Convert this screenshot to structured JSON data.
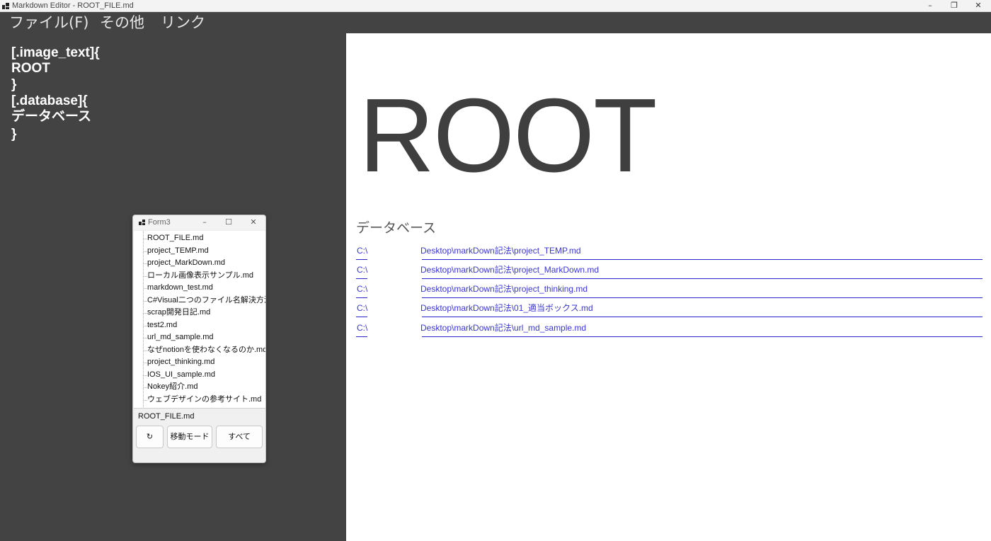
{
  "window": {
    "title": "Markdown Editor - ROOT_FILE.md",
    "controls": {
      "minimize": "–",
      "restore": "❐",
      "close": "✕"
    },
    "icon": "app-icon"
  },
  "menu": {
    "items": [
      "ファイル(F)",
      "その他",
      "リンク"
    ]
  },
  "editor": {
    "lines": [
      "[.image_text]{",
      "ROOT",
      "}",
      "[.database]{",
      "データベース",
      "}"
    ]
  },
  "preview": {
    "title": "ROOT",
    "section_heading": "データベース",
    "links": [
      {
        "drive": "C:\\",
        "path": "Desktop\\markDown記法\\project_TEMP.md"
      },
      {
        "drive": "C:\\",
        "path": "Desktop\\markDown記法\\project_MarkDown.md"
      },
      {
        "drive": "C:\\",
        "path": "Desktop\\markDown記法\\project_thinking.md"
      },
      {
        "drive": "C:\\",
        "path": "Desktop\\markDown記法\\01_適当ボックス.md"
      },
      {
        "drive": "C:\\",
        "path": "Desktop\\markDown記法\\url_md_sample.md"
      }
    ],
    "link_color": "#3a37d0"
  },
  "form3": {
    "title": "Form3",
    "controls": {
      "minimize": "–",
      "maximize": "☐",
      "close": "✕"
    },
    "files": [
      "ROOT_FILE.md",
      "project_TEMP.md",
      "project_MarkDown.md",
      "ローカル画像表示サンプル.md",
      "markdown_test.md",
      "C#Visual二つのファイル名解決方法.",
      "scrap開発日記.md",
      "test2.md",
      "url_md_sample.md",
      "なぜnotionを使わなくなるのか.md",
      "project_thinking.md",
      "IOS_UI_sample.md",
      "Nokey紹介.md",
      "ウェブデザインの参考サイト.md"
    ],
    "selected_file": "ROOT_FILE.md",
    "buttons": {
      "refresh": "↻",
      "move_mode": "移動モード",
      "all": "すべて"
    }
  },
  "colors": {
    "dark_bg": "#434343",
    "preview_bg": "#ffffff",
    "title_gray": "#3f3f3f"
  }
}
